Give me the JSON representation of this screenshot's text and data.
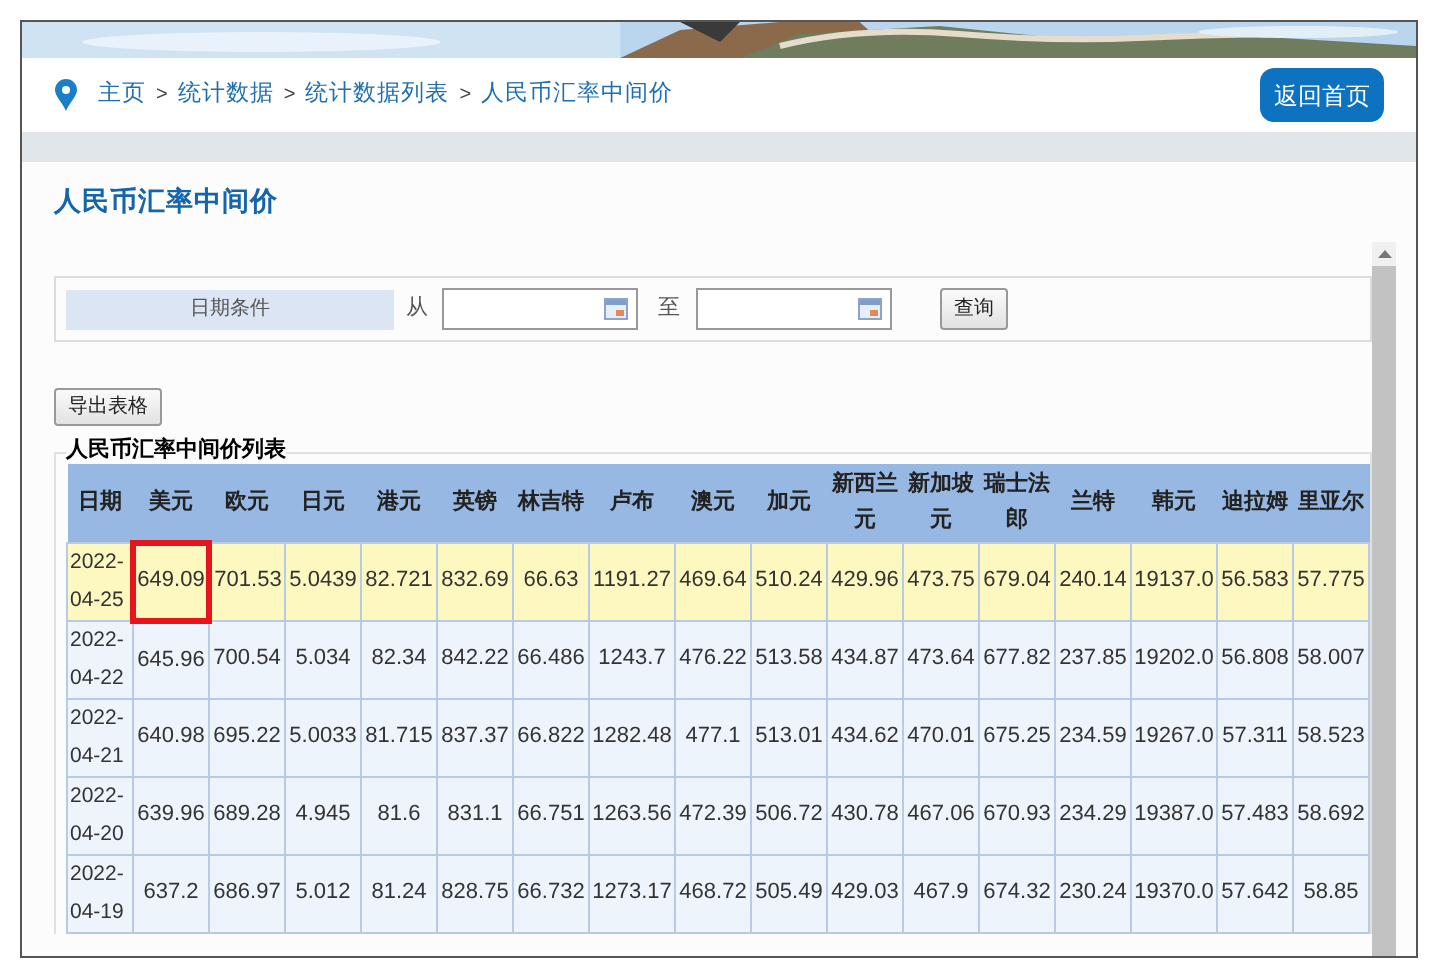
{
  "breadcrumb": [
    "主页",
    "统计数据",
    "统计数据列表",
    "人民币汇率中间价"
  ],
  "breadcrumb_separator": ">",
  "home_button": "返回首页",
  "page_title": "人民币汇率中间价",
  "filter": {
    "label": "日期条件",
    "from_label": "从",
    "to_label": "至",
    "search_button": "查询"
  },
  "export_button": "导出表格",
  "table": {
    "caption": "人民币汇率中间价列表",
    "columns": [
      "日期",
      "美元",
      "欧元",
      "日元",
      "港元",
      "英镑",
      "林吉特",
      "卢布",
      "澳元",
      "加元",
      "新西兰元",
      "新加坡元",
      "瑞士法郎",
      "兰特",
      "韩元",
      "迪拉姆",
      "里亚尔"
    ],
    "rows": [
      {
        "selected": true,
        "cells": [
          {
            "text": "2022-04-25",
            "outlined": false
          },
          {
            "text": "649.09",
            "outlined": true
          },
          {
            "text": "701.53",
            "outlined": false
          },
          {
            "text": "5.0439",
            "outlined": false
          },
          {
            "text": "82.721",
            "outlined": false
          },
          {
            "text": "832.69",
            "outlined": false
          },
          {
            "text": "66.63",
            "outlined": false
          },
          {
            "text": "1191.27",
            "outlined": false
          },
          {
            "text": "469.64",
            "outlined": false
          },
          {
            "text": "510.24",
            "outlined": false
          },
          {
            "text": "429.96",
            "outlined": false
          },
          {
            "text": "473.75",
            "outlined": false
          },
          {
            "text": "679.04",
            "outlined": false
          },
          {
            "text": "240.14",
            "outlined": false
          },
          {
            "text": "19137.0",
            "outlined": false
          },
          {
            "text": "56.583",
            "outlined": false
          },
          {
            "text": "57.775",
            "outlined": false
          }
        ]
      },
      {
        "selected": false,
        "cells": [
          {
            "text": "2022-04-22",
            "outlined": false
          },
          {
            "text": "645.96",
            "outlined": false
          },
          {
            "text": "700.54",
            "outlined": false
          },
          {
            "text": "5.034",
            "outlined": false
          },
          {
            "text": "82.34",
            "outlined": false
          },
          {
            "text": "842.22",
            "outlined": false
          },
          {
            "text": "66.486",
            "outlined": false
          },
          {
            "text": "1243.7",
            "outlined": false
          },
          {
            "text": "476.22",
            "outlined": false
          },
          {
            "text": "513.58",
            "outlined": false
          },
          {
            "text": "434.87",
            "outlined": false
          },
          {
            "text": "473.64",
            "outlined": false
          },
          {
            "text": "677.82",
            "outlined": false
          },
          {
            "text": "237.85",
            "outlined": false
          },
          {
            "text": "19202.0",
            "outlined": false
          },
          {
            "text": "56.808",
            "outlined": false
          },
          {
            "text": "58.007",
            "outlined": false
          }
        ]
      },
      {
        "selected": false,
        "cells": [
          {
            "text": "2022-04-21",
            "outlined": false
          },
          {
            "text": "640.98",
            "outlined": false
          },
          {
            "text": "695.22",
            "outlined": false
          },
          {
            "text": "5.0033",
            "outlined": false
          },
          {
            "text": "81.715",
            "outlined": false
          },
          {
            "text": "837.37",
            "outlined": false
          },
          {
            "text": "66.822",
            "outlined": false
          },
          {
            "text": "1282.48",
            "outlined": false
          },
          {
            "text": "477.1",
            "outlined": false
          },
          {
            "text": "513.01",
            "outlined": false
          },
          {
            "text": "434.62",
            "outlined": false
          },
          {
            "text": "470.01",
            "outlined": false
          },
          {
            "text": "675.25",
            "outlined": false
          },
          {
            "text": "234.59",
            "outlined": false
          },
          {
            "text": "19267.0",
            "outlined": false
          },
          {
            "text": "57.311",
            "outlined": false
          },
          {
            "text": "58.523",
            "outlined": false
          }
        ]
      },
      {
        "selected": false,
        "cells": [
          {
            "text": "2022-04-20",
            "outlined": false
          },
          {
            "text": "639.96",
            "outlined": false
          },
          {
            "text": "689.28",
            "outlined": false
          },
          {
            "text": "4.945",
            "outlined": false
          },
          {
            "text": "81.6",
            "outlined": false
          },
          {
            "text": "831.1",
            "outlined": false
          },
          {
            "text": "66.751",
            "outlined": false
          },
          {
            "text": "1263.56",
            "outlined": false
          },
          {
            "text": "472.39",
            "outlined": false
          },
          {
            "text": "506.72",
            "outlined": false
          },
          {
            "text": "430.78",
            "outlined": false
          },
          {
            "text": "467.06",
            "outlined": false
          },
          {
            "text": "670.93",
            "outlined": false
          },
          {
            "text": "234.29",
            "outlined": false
          },
          {
            "text": "19387.0",
            "outlined": false
          },
          {
            "text": "57.483",
            "outlined": false
          },
          {
            "text": "58.692",
            "outlined": false
          }
        ]
      },
      {
        "selected": false,
        "cells": [
          {
            "text": "2022-04-19",
            "outlined": false
          },
          {
            "text": "637.2",
            "outlined": false
          },
          {
            "text": "686.97",
            "outlined": false
          },
          {
            "text": "5.012",
            "outlined": false
          },
          {
            "text": "81.24",
            "outlined": false
          },
          {
            "text": "828.75",
            "outlined": false
          },
          {
            "text": "66.732",
            "outlined": false
          },
          {
            "text": "1273.17",
            "outlined": false
          },
          {
            "text": "468.72",
            "outlined": false
          },
          {
            "text": "505.49",
            "outlined": false
          },
          {
            "text": "429.03",
            "outlined": false
          },
          {
            "text": "467.9",
            "outlined": false
          },
          {
            "text": "674.32",
            "outlined": false
          },
          {
            "text": "230.24",
            "outlined": false
          },
          {
            "text": "19370.0",
            "outlined": false
          },
          {
            "text": "57.642",
            "outlined": false
          },
          {
            "text": "58.85",
            "outlined": false
          }
        ]
      }
    ]
  }
}
